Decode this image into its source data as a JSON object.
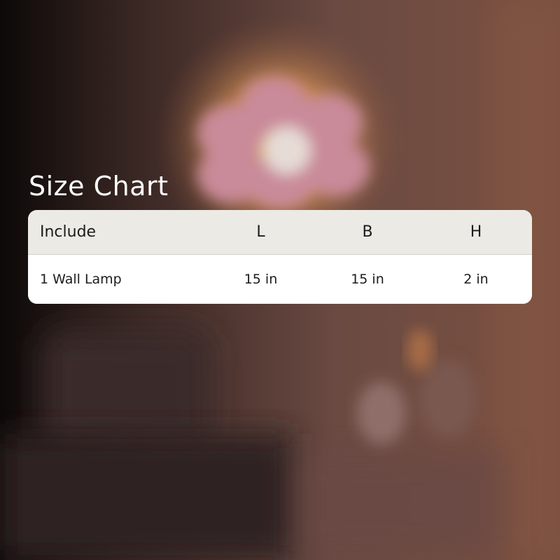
{
  "page": {
    "title": "Size Chart"
  },
  "table": {
    "headers": [
      "Include",
      "L",
      "B",
      "H"
    ],
    "rows": [
      [
        "1 Wall Lamp",
        "15 in",
        "15 in",
        "2 in"
      ]
    ]
  },
  "background": {
    "description_icons": [
      "flower-lamp-icon"
    ],
    "colors": {
      "glow": "#f2a25a",
      "petals": "#c98a9a",
      "room": "#5a3a33"
    }
  }
}
